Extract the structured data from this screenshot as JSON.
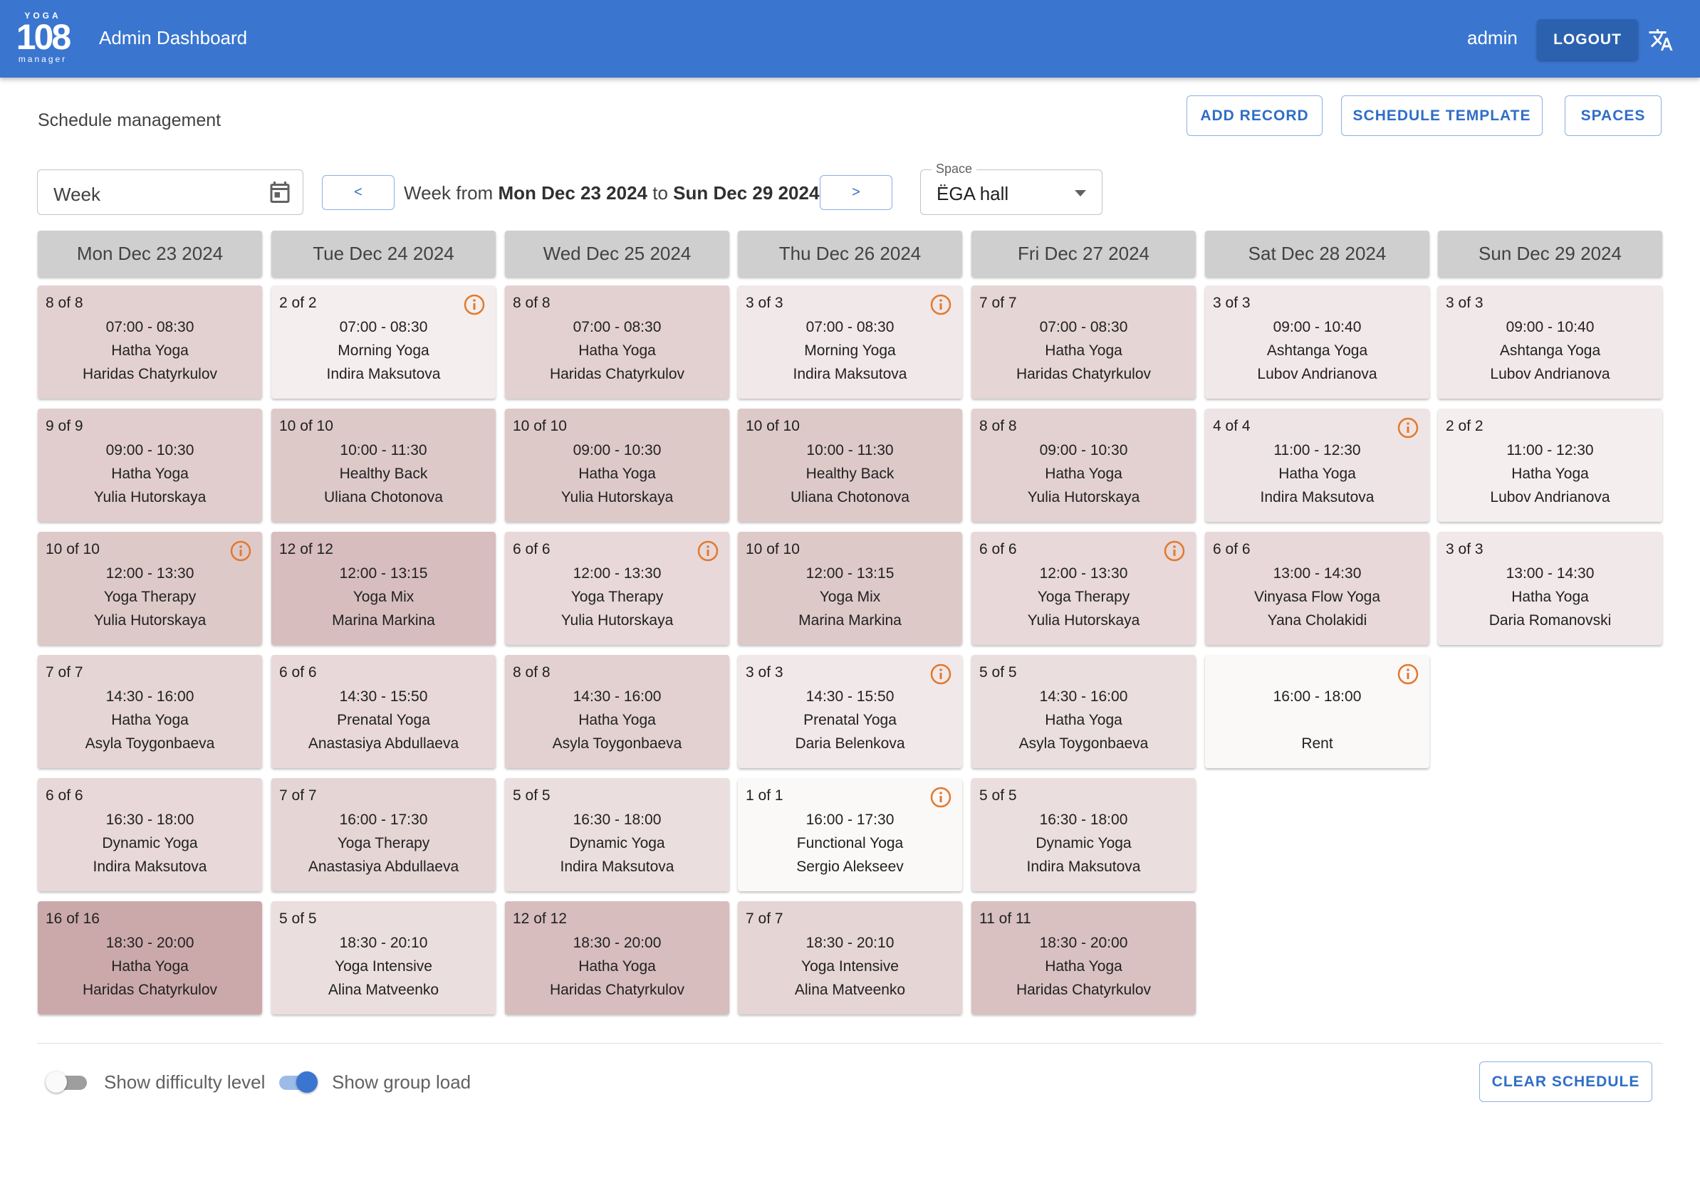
{
  "header": {
    "logo": {
      "top": "YOGA",
      "number": "108",
      "bottom": "manager"
    },
    "title": "Admin Dashboard",
    "user": "admin",
    "logout_label": "LOGOUT",
    "bar_color": "#3a76cf"
  },
  "toolbar": {
    "section_title": "Schedule management",
    "add_record_label": "ADD RECORD",
    "schedule_template_label": "SCHEDULE TEMPLATE",
    "spaces_label": "SPACES"
  },
  "filters": {
    "period_value": "Week",
    "prev_label": "<",
    "next_label": ">",
    "week_prefix": "Week from",
    "week_start": "Mon Dec 23 2024",
    "week_to": "to",
    "week_end": "Sun Dec 29 2024",
    "space_label": "Space",
    "space_value": "ËGA hall"
  },
  "days": [
    {
      "label": "Mon Dec 23 2024",
      "sessions": [
        {
          "count": "8 of 8",
          "time": "07:00 - 08:30",
          "class": "Hatha Yoga",
          "teacher": "Haridas Chatyrkulov",
          "info": false,
          "load": 0.5
        },
        {
          "count": "9 of 9",
          "time": "09:00 - 10:30",
          "class": "Hatha Yoga",
          "teacher": "Yulia Hutorskaya",
          "info": false,
          "load": 0.55
        },
        {
          "count": "10 of 10",
          "time": "12:00 - 13:30",
          "class": "Yoga Therapy",
          "teacher": "Yulia Hutorskaya",
          "info": true,
          "load": 0.6
        },
        {
          "count": "7 of 7",
          "time": "14:30 - 16:00",
          "class": "Hatha Yoga",
          "teacher": "Asyla Toygonbaeva",
          "info": false,
          "load": 0.45
        },
        {
          "count": "6 of 6",
          "time": "16:30 - 18:00",
          "class": "Dynamic Yoga",
          "teacher": "Indira Maksutova",
          "info": false,
          "load": 0.4
        },
        {
          "count": "16 of 16",
          "time": "18:30 - 20:00",
          "class": "Hatha Yoga",
          "teacher": "Haridas Chatyrkulov",
          "info": false,
          "load": 1.0
        }
      ]
    },
    {
      "label": "Tue Dec 24 2024",
      "sessions": [
        {
          "count": "2 of 2",
          "time": "07:00 - 08:30",
          "class": "Morning Yoga",
          "teacher": "Indira Maksutova",
          "info": true,
          "load": 0.13
        },
        {
          "count": "10 of 10",
          "time": "10:00 - 11:30",
          "class": "Healthy Back",
          "teacher": "Uliana Chotonova",
          "info": false,
          "load": 0.6
        },
        {
          "count": "12 of 12",
          "time": "12:00 - 13:15",
          "class": "Yoga Mix",
          "teacher": "Marina Markina",
          "info": false,
          "load": 0.75
        },
        {
          "count": "6 of 6",
          "time": "14:30 - 15:50",
          "class": "Prenatal Yoga",
          "teacher": "Anastasiya Abdullaeva",
          "info": false,
          "load": 0.4
        },
        {
          "count": "7 of 7",
          "time": "16:00 - 17:30",
          "class": "Yoga Therapy",
          "teacher": "Anastasiya Abdullaeva",
          "info": false,
          "load": 0.45
        },
        {
          "count": "5 of 5",
          "time": "18:30 - 20:10",
          "class": "Yoga Intensive",
          "teacher": "Alina Matveenko",
          "info": false,
          "load": 0.33
        }
      ]
    },
    {
      "label": "Wed Dec 25 2024",
      "sessions": [
        {
          "count": "8 of 8",
          "time": "07:00 - 08:30",
          "class": "Hatha Yoga",
          "teacher": "Haridas Chatyrkulov",
          "info": false,
          "load": 0.5
        },
        {
          "count": "10 of 10",
          "time": "09:00 - 10:30",
          "class": "Hatha Yoga",
          "teacher": "Yulia Hutorskaya",
          "info": false,
          "load": 0.6
        },
        {
          "count": "6 of 6",
          "time": "12:00 - 13:30",
          "class": "Yoga Therapy",
          "teacher": "Yulia Hutorskaya",
          "info": true,
          "load": 0.4
        },
        {
          "count": "8 of 8",
          "time": "14:30 - 16:00",
          "class": "Hatha Yoga",
          "teacher": "Asyla Toygonbaeva",
          "info": false,
          "load": 0.5
        },
        {
          "count": "5 of 5",
          "time": "16:30 - 18:00",
          "class": "Dynamic Yoga",
          "teacher": "Indira Maksutova",
          "info": false,
          "load": 0.33
        },
        {
          "count": "12 of 12",
          "time": "18:30 - 20:00",
          "class": "Hatha Yoga",
          "teacher": "Haridas Chatyrkulov",
          "info": false,
          "load": 0.75
        }
      ]
    },
    {
      "label": "Thu Dec 26 2024",
      "sessions": [
        {
          "count": "3 of 3",
          "time": "07:00 - 08:30",
          "class": "Morning Yoga",
          "teacher": "Indira Maksutova",
          "info": true,
          "load": 0.2
        },
        {
          "count": "10 of 10",
          "time": "10:00 - 11:30",
          "class": "Healthy Back",
          "teacher": "Uliana Chotonova",
          "info": false,
          "load": 0.6
        },
        {
          "count": "10 of 10",
          "time": "12:00 - 13:15",
          "class": "Yoga Mix",
          "teacher": "Marina Markina",
          "info": false,
          "load": 0.6
        },
        {
          "count": "3 of 3",
          "time": "14:30 - 15:50",
          "class": "Prenatal Yoga",
          "teacher": "Daria Belenkova",
          "info": true,
          "load": 0.2
        },
        {
          "count": "1 of 1",
          "time": "16:00 - 17:30",
          "class": "Functional Yoga",
          "teacher": "Sergio Alekseev",
          "info": true,
          "load": 0.0
        },
        {
          "count": "7 of 7",
          "time": "18:30 - 20:10",
          "class": "Yoga Intensive",
          "teacher": "Alina Matveenko",
          "info": false,
          "load": 0.45
        }
      ]
    },
    {
      "label": "Fri Dec 27 2024",
      "sessions": [
        {
          "count": "7 of 7",
          "time": "07:00 - 08:30",
          "class": "Hatha Yoga",
          "teacher": "Haridas Chatyrkulov",
          "info": false,
          "load": 0.45
        },
        {
          "count": "8 of 8",
          "time": "09:00 - 10:30",
          "class": "Hatha Yoga",
          "teacher": "Yulia Hutorskaya",
          "info": false,
          "load": 0.5
        },
        {
          "count": "6 of 6",
          "time": "12:00 - 13:30",
          "class": "Yoga Therapy",
          "teacher": "Yulia Hutorskaya",
          "info": true,
          "load": 0.4
        },
        {
          "count": "5 of 5",
          "time": "14:30 - 16:00",
          "class": "Hatha Yoga",
          "teacher": "Asyla Toygonbaeva",
          "info": false,
          "load": 0.33
        },
        {
          "count": "5 of 5",
          "time": "16:30 - 18:00",
          "class": "Dynamic Yoga",
          "teacher": "Indira Maksutova",
          "info": false,
          "load": 0.33
        },
        {
          "count": "11 of 11",
          "time": "18:30 - 20:00",
          "class": "Hatha Yoga",
          "teacher": "Haridas Chatyrkulov",
          "info": false,
          "load": 0.7
        }
      ]
    },
    {
      "label": "Sat Dec 28 2024",
      "sessions": [
        {
          "count": "3 of 3",
          "time": "09:00 - 10:40",
          "class": "Ashtanga Yoga",
          "teacher": "Lubov Andrianova",
          "info": false,
          "load": 0.2
        },
        {
          "count": "4 of 4",
          "time": "11:00 - 12:30",
          "class": "Hatha Yoga",
          "teacher": "Indira Maksutova",
          "info": true,
          "load": 0.25
        },
        {
          "count": "6 of 6",
          "time": "13:00 - 14:30",
          "class": "Vinyasa Flow Yoga",
          "teacher": "Yana Cholakidi",
          "info": false,
          "load": 0.4
        },
        {
          "count": "",
          "time": "16:00 - 18:00",
          "class": "",
          "teacher": "Rent",
          "info": true,
          "load": 0.0
        }
      ]
    },
    {
      "label": "Sun Dec 29 2024",
      "sessions": [
        {
          "count": "3 of 3",
          "time": "09:00 - 10:40",
          "class": "Ashtanga Yoga",
          "teacher": "Lubov Andrianova",
          "info": false,
          "load": 0.2
        },
        {
          "count": "2 of 2",
          "time": "11:00 - 12:30",
          "class": "Hatha Yoga",
          "teacher": "Lubov Andrianova",
          "info": false,
          "load": 0.13
        },
        {
          "count": "3 of 3",
          "time": "13:00 - 14:30",
          "class": "Hatha Yoga",
          "teacher": "Daria Romanovski",
          "info": false,
          "load": 0.2
        }
      ]
    }
  ],
  "footer": {
    "difficulty_label": "Show difficulty level",
    "difficulty_on": false,
    "group_load_label": "Show group load",
    "group_load_on": true,
    "clear_label": "CLEAR SCHEDULE"
  },
  "colors": {
    "primary": "#3a76cf",
    "accent_text": "#2f6ec7",
    "info_icon": "#e07a2e",
    "load_low": "#ffffff",
    "load_high": "#cba9aa"
  }
}
